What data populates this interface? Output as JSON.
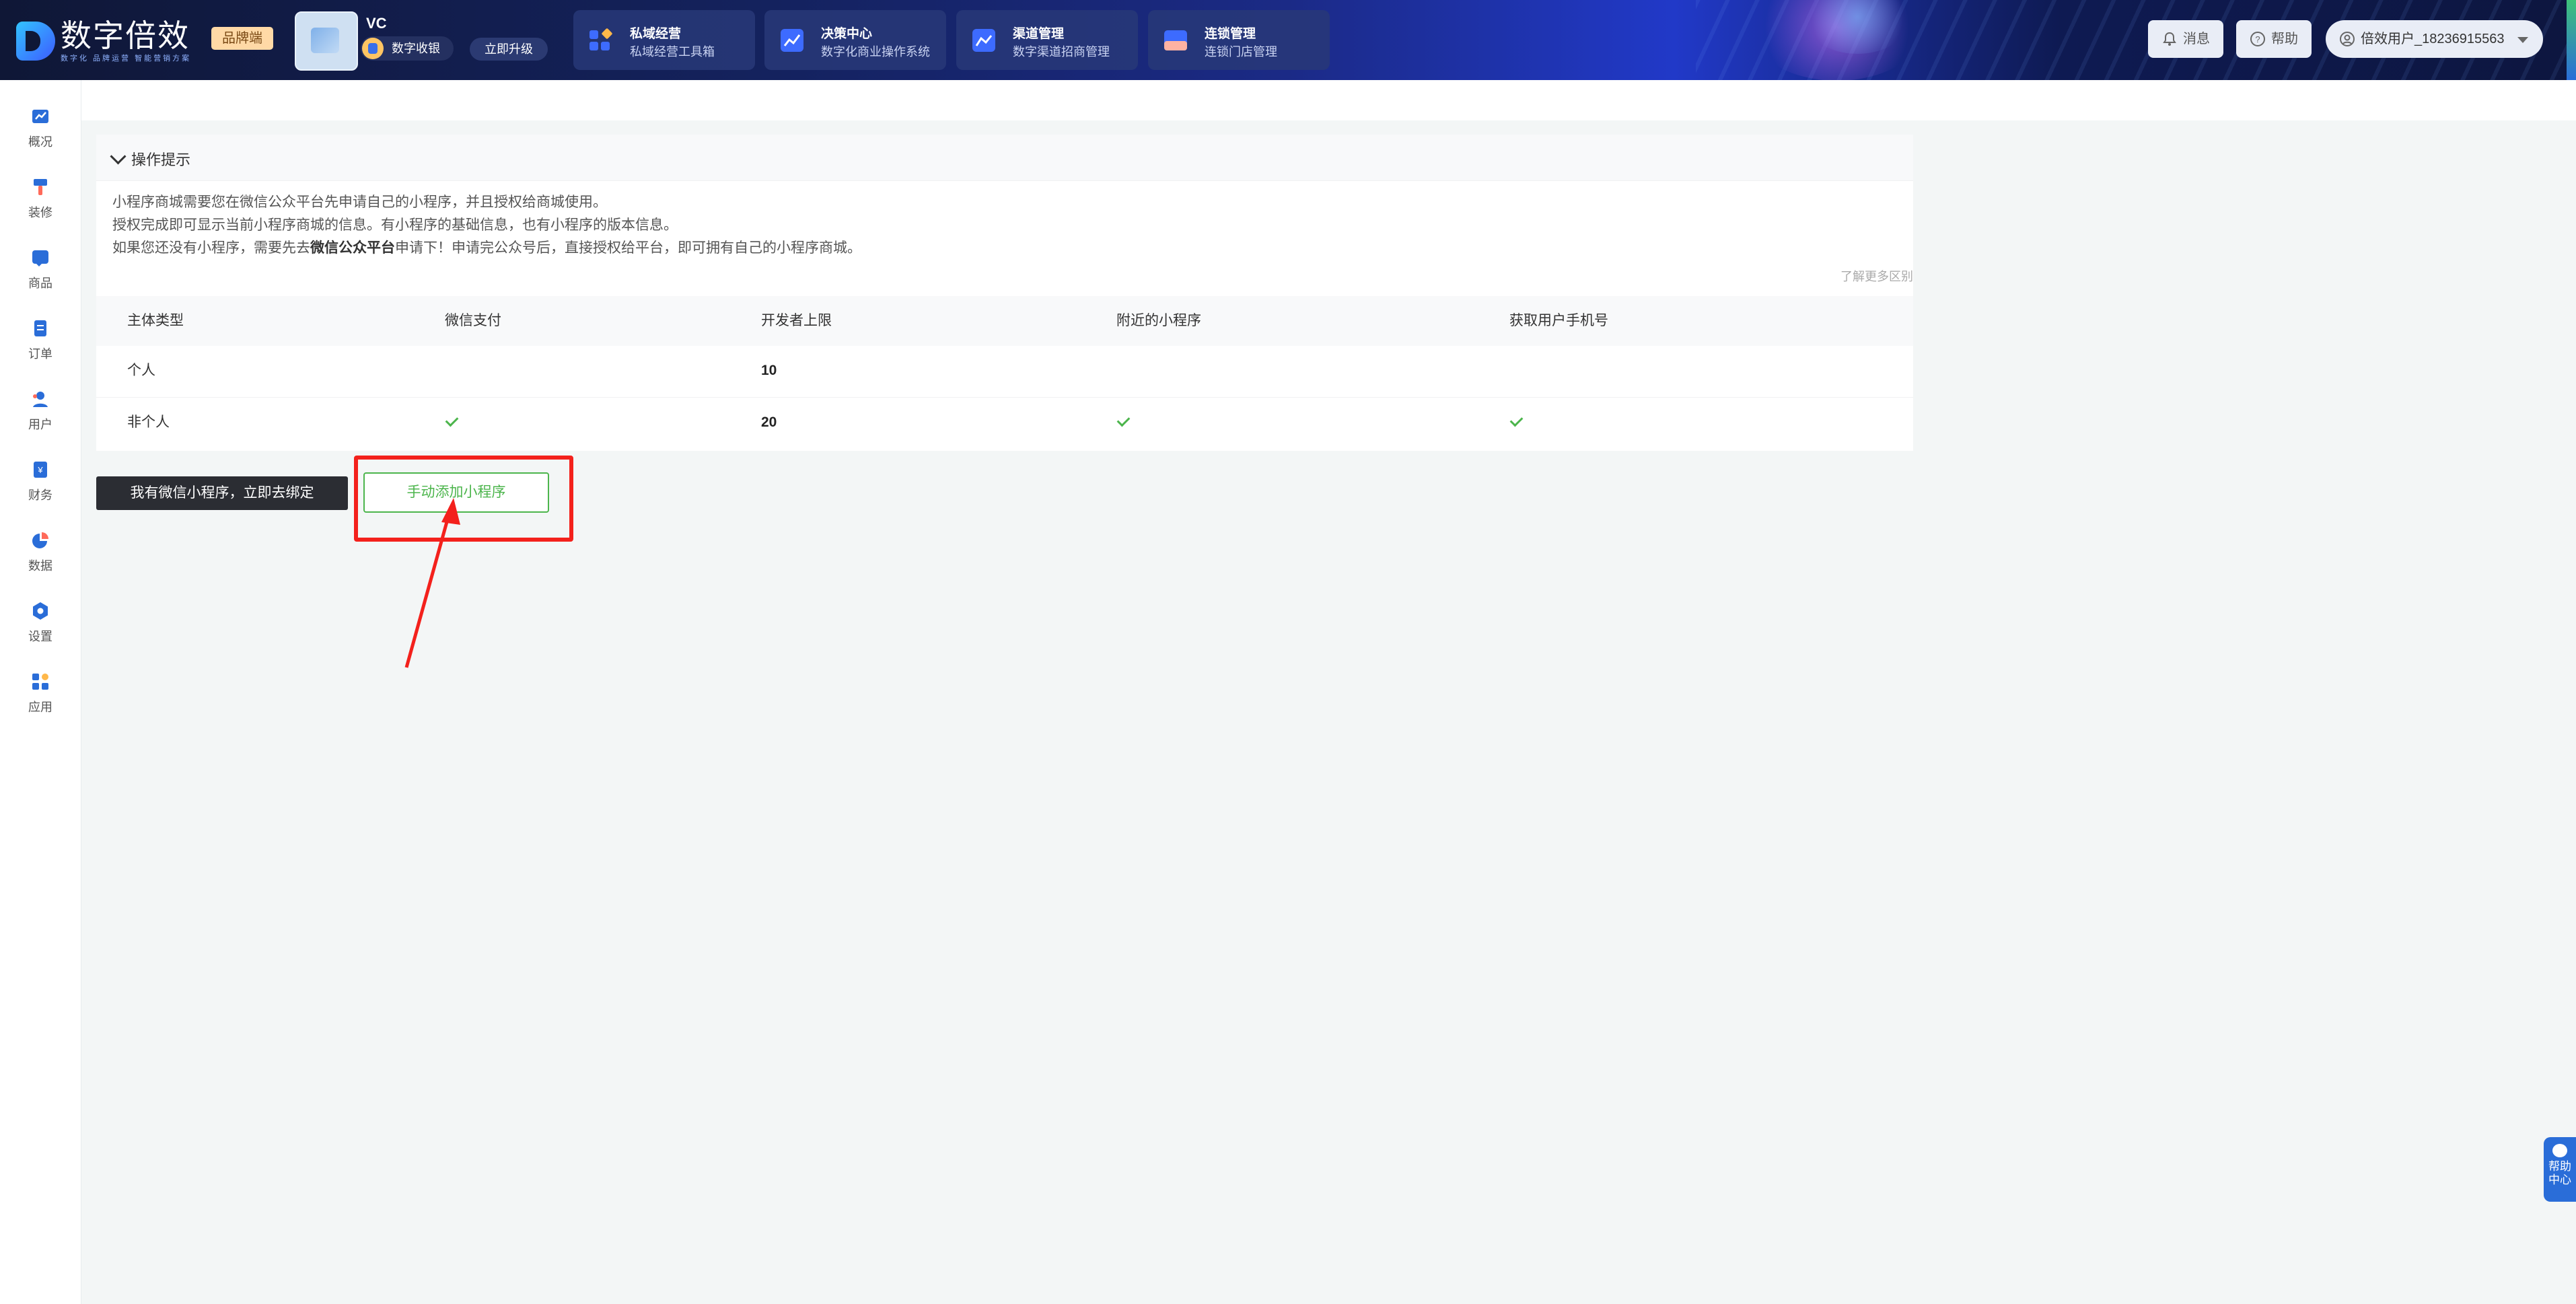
{
  "header": {
    "logo_title": "数字倍效",
    "logo_sub": "数字化 品牌运营 智能营销方案",
    "brand_tag": "品牌端",
    "store_name": "VC",
    "vip_label": "数字收银",
    "upgrade_label": "立即升级",
    "nav": [
      {
        "title": "私域经营",
        "sub": "私域经营工具箱"
      },
      {
        "title": "决策中心",
        "sub": "数字化商业操作系统"
      },
      {
        "title": "渠道管理",
        "sub": "数字渠道招商管理"
      },
      {
        "title": "连锁管理",
        "sub": "连锁门店管理"
      }
    ],
    "message_label": "消息",
    "help_label": "帮助",
    "user_label": "倍效用户_18236915563"
  },
  "sidebar": {
    "items": [
      {
        "label": "概况",
        "icon": "chart-icon"
      },
      {
        "label": "装修",
        "icon": "brush-icon"
      },
      {
        "label": "商品",
        "icon": "goods-icon"
      },
      {
        "label": "订单",
        "icon": "order-icon"
      },
      {
        "label": "用户",
        "icon": "user-icon"
      },
      {
        "label": "财务",
        "icon": "finance-icon"
      },
      {
        "label": "数据",
        "icon": "pie-icon"
      },
      {
        "label": "设置",
        "icon": "settings-icon"
      },
      {
        "label": "应用",
        "icon": "apps-icon"
      }
    ]
  },
  "tips": {
    "title": "操作提示",
    "line1": "小程序商城需要您在微信公众平台先申请自己的小程序，并且授权给商城使用。",
    "line2": "授权完成即可显示当前小程序商城的信息。有小程序的基础信息，也有小程序的版本信息。",
    "line3_pre": "如果您还没有小程序，需要先去",
    "line3_bold": "微信公众平台",
    "line3_post": "申请下！申请完公众号后，直接授权给平台，即可拥有自己的小程序商城。",
    "more_link": "了解更多区别"
  },
  "table": {
    "headers": [
      "主体类型",
      "微信支付",
      "开发者上限",
      "附近的小程序",
      "获取用户手机号"
    ],
    "rows": [
      {
        "type": "个人",
        "pay": false,
        "limit": "10",
        "nearby": false,
        "phone": false
      },
      {
        "type": "非个人",
        "pay": true,
        "limit": "20",
        "nearby": true,
        "phone": true
      }
    ]
  },
  "actions": {
    "bind_label": "我有微信小程序，立即去绑定",
    "add_label": "手动添加小程序"
  },
  "help_float": {
    "line1": "帮助",
    "line2": "中心"
  },
  "colors": {
    "accent_green": "#4cb54c",
    "highlight_red": "#f3211c",
    "primary_blue": "#2a6dd8"
  }
}
